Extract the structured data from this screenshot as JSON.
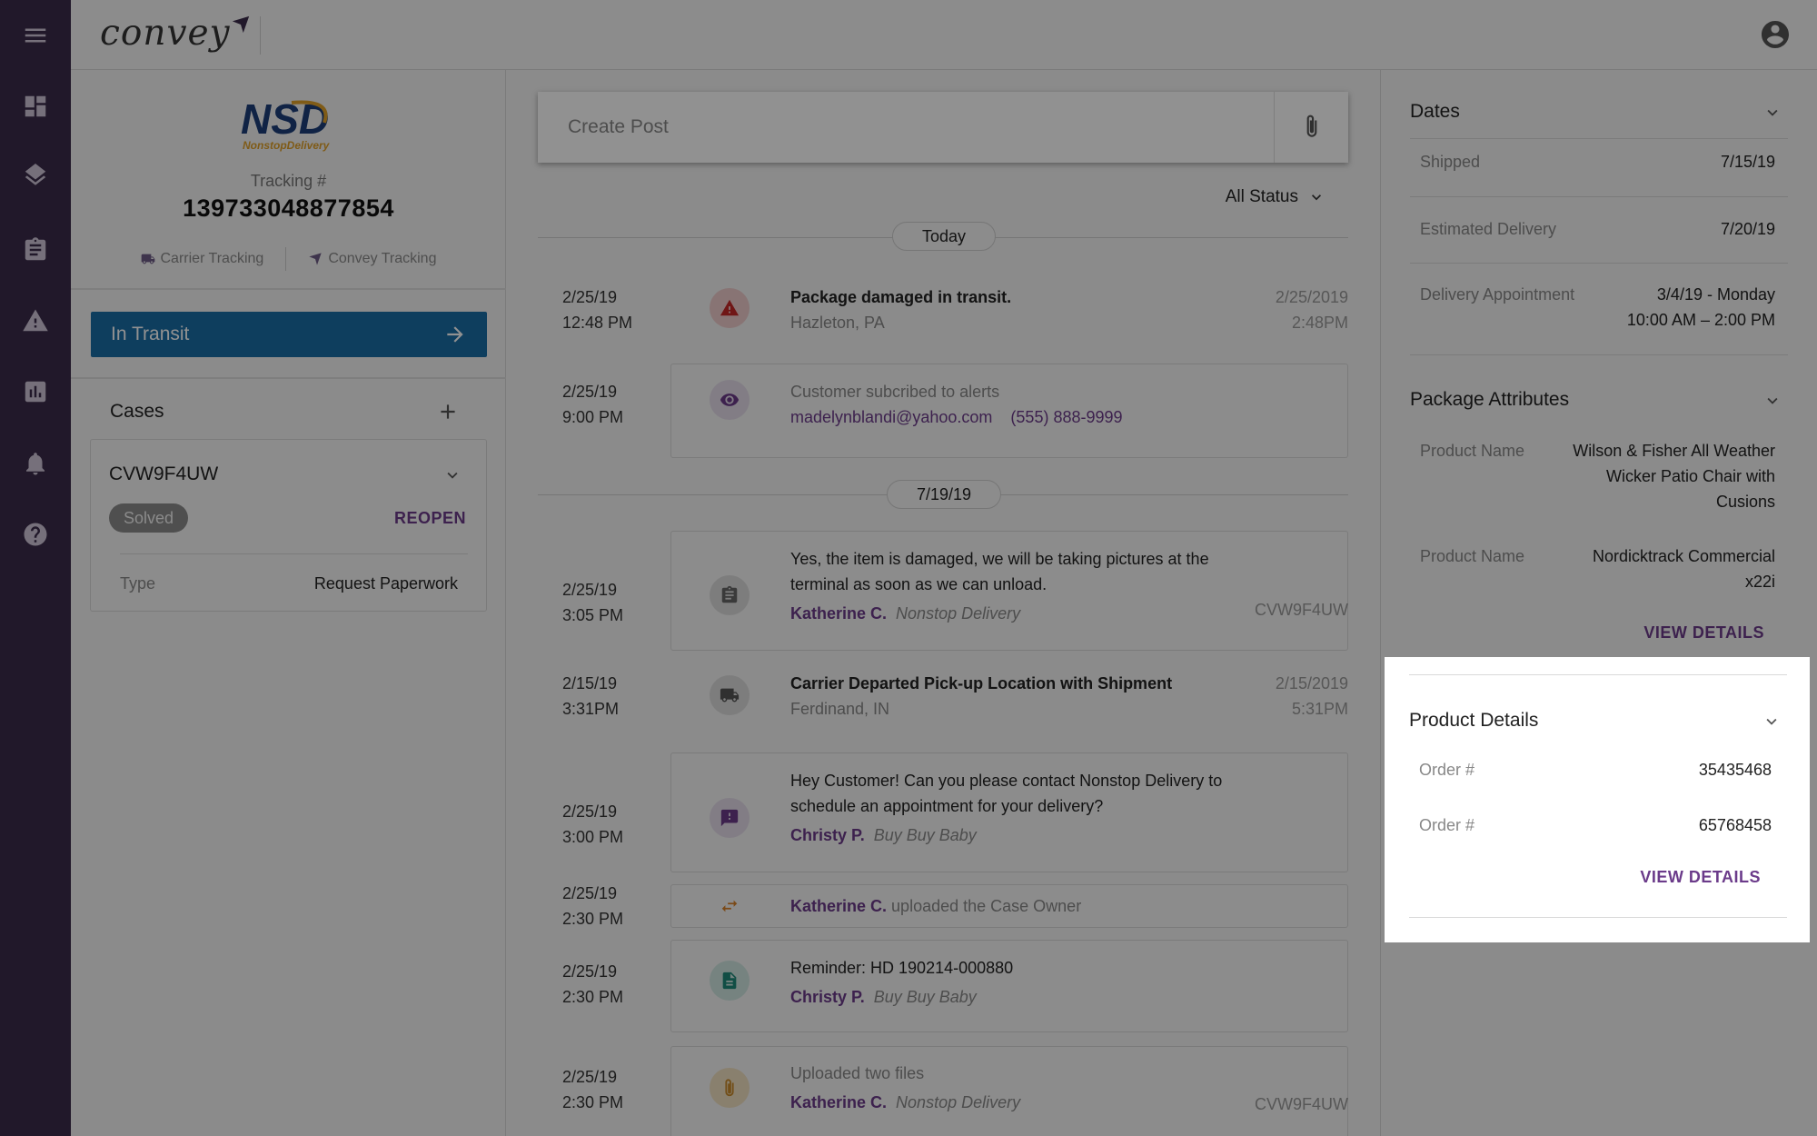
{
  "app": {
    "logo_text": "convey"
  },
  "rail": {
    "items": [
      "menu-icon",
      "dashboard-icon",
      "layers-icon",
      "clipboard-icon",
      "warning-icon",
      "chart-icon",
      "bell-icon",
      "help-icon"
    ]
  },
  "shipment": {
    "carrier_logo_text": "NSD",
    "carrier_logo_sub": "NonstopDelivery",
    "tracking_label": "Tracking #",
    "tracking_number": "139733048877854",
    "carrier_tracking": "Carrier Tracking",
    "convey_tracking": "Convey Tracking",
    "status": "In Transit"
  },
  "cases": {
    "title": "Cases",
    "case_id": "CVW9F4UW",
    "badge": "Solved",
    "reopen": "REOPEN",
    "type_label": "Type",
    "type_value": "Request Paperwork"
  },
  "feed": {
    "post_placeholder": "Create Post",
    "filter": "All Status",
    "date_today": "Today",
    "date_2": "7/19/19",
    "items": [
      {
        "date": "2/25/19",
        "time": "12:48 PM",
        "title": "Package damaged in transit.",
        "location": "Hazleton, PA",
        "right_date": "2/25/2019",
        "right_time": "2:48PM",
        "icon": "alert-icon"
      },
      {
        "date": "2/25/19",
        "time": "9:00 PM",
        "title": "Customer subcribed to alerts",
        "email": "madelynblandi@yahoo.com",
        "phone": "(555) 888-9999",
        "icon": "eye-icon"
      },
      {
        "date": "2/25/19",
        "time": "3:05 PM",
        "line1": "Yes, the item is damaged, we will be taking pictures at the",
        "line2": "terminal as soon as we can unload.",
        "author": "Katherine C.",
        "org": "Nonstop Delivery",
        "ref": "CVW9F4UW",
        "icon": "clipboard-icon"
      },
      {
        "date": "2/15/19",
        "time": "3:31PM",
        "title": "Carrier Departed Pick-up Location with Shipment",
        "location": "Ferdinand, IN",
        "right_date": "2/15/2019",
        "right_time": "5:31PM",
        "icon": "truck-icon"
      },
      {
        "date": "2/25/19",
        "time": "3:00 PM",
        "line1": "Hey Customer! Can you please contact Nonstop Delivery to",
        "line2": "schedule an appointment for your delivery?",
        "author": "Christy P.",
        "org": "Buy Buy Baby",
        "icon": "message-alert-icon"
      },
      {
        "date": "2/25/19",
        "time": "2:30 PM",
        "author": "Katherine C.",
        "action": "uploaded the Case Owner",
        "icon": "swap-icon"
      },
      {
        "date": "2/25/19",
        "time": "2:30 PM",
        "title": "Reminder: HD 190214-000880",
        "author": "Christy P.",
        "org": "Buy Buy Baby",
        "icon": "document-icon"
      },
      {
        "date": "2/25/19",
        "time": "2:30 PM",
        "title": "Uploaded two files",
        "author": "Katherine C.",
        "org": "Nonstop Delivery",
        "ref": "CVW9F4UW",
        "icon": "paperclip-icon"
      }
    ]
  },
  "dates": {
    "title": "Dates",
    "shipped_label": "Shipped",
    "shipped_value": "7/15/19",
    "est_label": "Estimated Delivery",
    "est_value": "7/20/19",
    "appt_label": "Delivery Appointment",
    "appt_value_1": "3/4/19 - Monday",
    "appt_value_2": "10:00 AM – 2:00 PM"
  },
  "package_attributes": {
    "title": "Package Attributes",
    "p1_label": "Product Name",
    "p1_lines": [
      "Wilson & Fisher All Weather",
      "Wicker Patio Chair with",
      "Cusions"
    ],
    "p2_label": "Product Name",
    "p2_lines": [
      "Nordicktrack Commercial",
      "x22i"
    ],
    "view_details": "VIEW DETAILS"
  },
  "product_details": {
    "title": "Product Details",
    "o1_label": "Order #",
    "o1_value": "35435468",
    "o2_label": "Order #",
    "o2_value": "65768458",
    "view_details": "VIEW DETAILS"
  },
  "colors": {
    "rail": "#3a2b4a",
    "primary_blue": "#1a6da6",
    "accent_purple": "#6b3b8a",
    "alert_red": "#c62828",
    "truck_gray": "#555555",
    "swap_orange": "#d9822b",
    "doc_teal": "#1f8a7a",
    "clip_orange": "#c98a2a"
  }
}
